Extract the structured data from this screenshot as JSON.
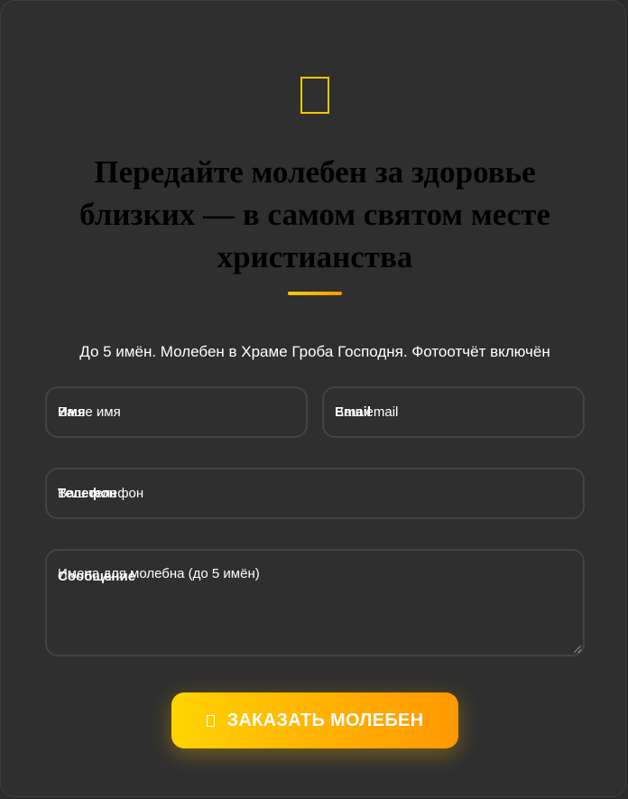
{
  "form": {
    "icon": "cross-icon",
    "title": "Передайте молебен за здоровье близких — в самом святом месте христианства",
    "subtitle": "До 5 имён. Молебен в Храме Гроба Господня. Фотоотчёт включён",
    "fields": {
      "name": {
        "label": "Имя",
        "placeholder": "Ваше имя"
      },
      "email": {
        "label": "Email",
        "placeholder": "Ваш email"
      },
      "phone": {
        "label": "Телефон",
        "placeholder": "Ваш телефон"
      },
      "message": {
        "label": "Сообщение",
        "placeholder": "Имена для молебна (до 5 имён)"
      }
    },
    "submit": {
      "icon": "cross-icon",
      "label": "ЗАКАЗАТЬ МОЛЕБЕН"
    }
  },
  "colors": {
    "background": "#2f2f2f",
    "accent_start": "#ffd400",
    "accent_end": "#ff9800",
    "field_border": "#444444",
    "text": "#ffffff"
  }
}
